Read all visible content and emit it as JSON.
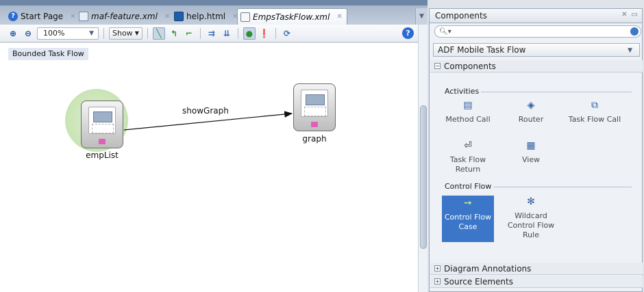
{
  "tabs": [
    {
      "label": "Start Page",
      "icon": "help-icon",
      "italic": false,
      "active": false
    },
    {
      "label": "maf-feature.xml",
      "icon": "xml-file-icon",
      "italic": true,
      "active": false
    },
    {
      "label": "help.html",
      "icon": "html-file-icon",
      "italic": false,
      "active": false
    },
    {
      "label": "EmpsTaskFlow.xml",
      "icon": "taskflow-file-icon",
      "italic": true,
      "active": true
    }
  ],
  "toolbar": {
    "zoom_value": "100%",
    "show_label": "Show"
  },
  "canvas": {
    "badge": "Bounded Task Flow",
    "nodes": {
      "emplist": "empList",
      "graph": "graph"
    },
    "edge_label": "showGraph"
  },
  "panel": {
    "title": "Components",
    "search_placeholder": "",
    "category": "ADF Mobile Task Flow",
    "section_components": "Components",
    "group_activities": "Activities",
    "activities": [
      {
        "label": "Method Call",
        "icon": "method-call-icon"
      },
      {
        "label": "Router",
        "icon": "router-icon"
      },
      {
        "label": "Task Flow Call",
        "icon": "task-flow-call-icon"
      },
      {
        "label": "Task Flow Return",
        "icon": "task-flow-return-icon"
      },
      {
        "label": "View",
        "icon": "view-icon"
      }
    ],
    "group_control_flow": "Control Flow",
    "control_flow": [
      {
        "label": "Control Flow Case",
        "icon": "control-flow-case-icon",
        "selected": true
      },
      {
        "label": "Wildcard Control Flow Rule",
        "icon": "wildcard-icon",
        "selected": false
      }
    ],
    "section_diagram_annotations": "Diagram Annotations",
    "section_source_elements": "Source Elements"
  }
}
